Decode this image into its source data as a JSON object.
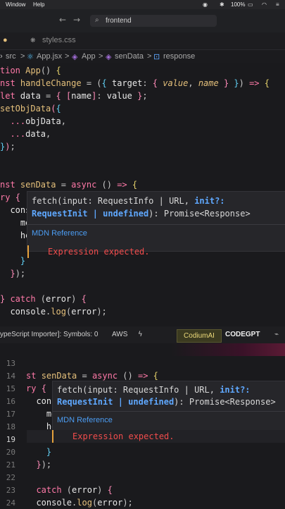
{
  "menubar": {
    "items": [
      "Window",
      "Help"
    ],
    "battery": "100%"
  },
  "titlebar": {
    "search_text": "frontend",
    "back_arrow": "←",
    "forward_arrow": "→"
  },
  "tabs": [
    {
      "label": "styles.css"
    }
  ],
  "breadcrumb": {
    "items": [
      "src",
      ">",
      "App.jsx",
      ">",
      "App",
      ">",
      "senData",
      ">",
      "response"
    ]
  },
  "code_top": [
    "tion App() {",
    "nst handleChange = ({ target: { value, name } }) => {",
    "let data = { [name]: value };",
    "setObjData({",
    "  ...objData,",
    "  ...data,",
    "});",
    "",
    "",
    "nst senData = async () => {",
    "ry {",
    "  consol",
    "    me",
    "    he",
    "",
    "    }",
    "  });",
    "",
    "} catch (error) {",
    "  console.log(error);"
  ],
  "popup": {
    "sig_line1": "fetch(input: RequestInfo | URL, init?:",
    "sig_line2": "RequestInit | undefined): Promise<Response>",
    "kw_init": "init?:",
    "kw_requestinit": "RequestInit | undefined",
    "mdn": "MDN Reference",
    "error": "Expression expected."
  },
  "statusbar": {
    "importer": "ypeScript Importer]: Symbols: 0",
    "aws": "AWS",
    "codium": "CodiumAI",
    "codegpt": "CODEGPT"
  },
  "lower": {
    "line_numbers": [
      "13",
      "14",
      "15",
      "16",
      "17",
      "18",
      "19",
      "20",
      "21",
      "22",
      "23",
      "24"
    ],
    "active_line": "19",
    "code": [
      "",
      "st senData = async () => {",
      "ry {",
      "  conso",
      "    me",
      "    he",
      "",
      "    }",
      "  });",
      "",
      "  catch (error) {",
      "  console.log(error);"
    ]
  },
  "colors": {
    "keyword": "#e06c75",
    "function": "#e5c07b",
    "error": "#f14c4c",
    "link": "#4c9df3",
    "codium_bg": "#3b3a20"
  }
}
